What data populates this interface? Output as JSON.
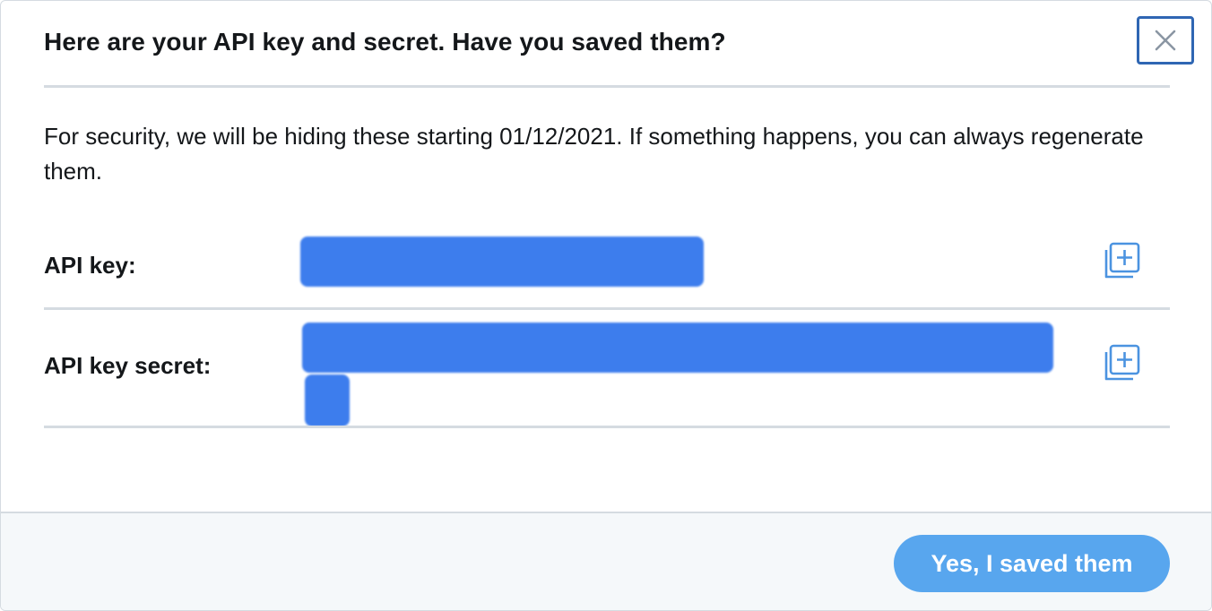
{
  "dialog": {
    "title": "Here are your API key and secret. Have you saved them?",
    "description": "For security, we will be hiding these starting 01/12/2021. If something happens, you can always regenerate them."
  },
  "fields": [
    {
      "label": "API key:",
      "copy_icon": "copy-add-icon"
    },
    {
      "label": "API key secret:",
      "copy_icon": "copy-add-icon"
    }
  ],
  "footer": {
    "confirm_label": "Yes, I saved them"
  },
  "icons": {
    "close": "close-icon"
  },
  "colors": {
    "accent": "#58a6ee",
    "close_border": "#2f66b3",
    "redaction": "#3d7ded",
    "icon_blue": "#4b93e0"
  }
}
